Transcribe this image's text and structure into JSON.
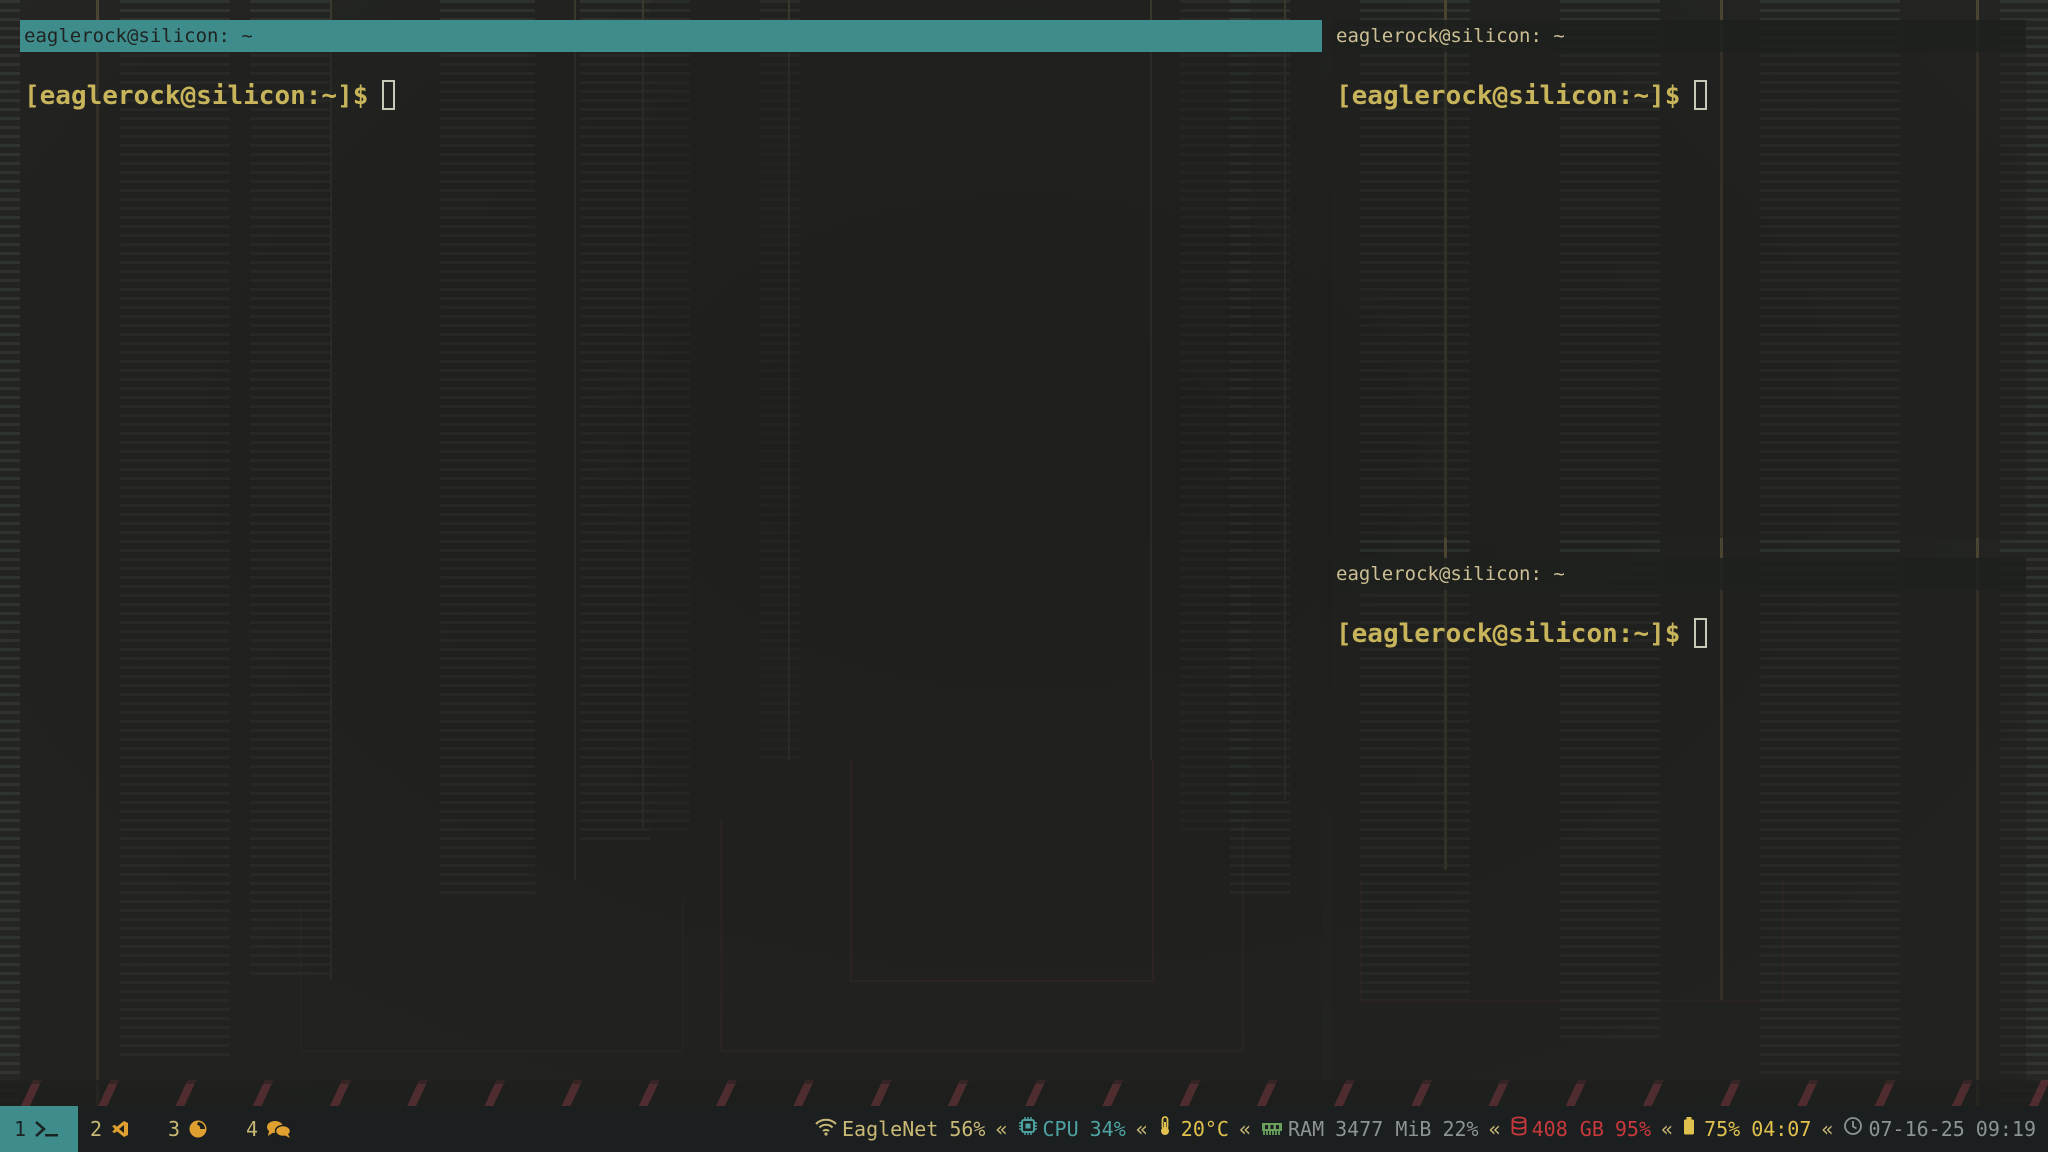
{
  "windows": {
    "main": {
      "title": "eaglerock@silicon: ~",
      "prompt": "[eaglerock@silicon:~]$",
      "focused": true
    },
    "top_right": {
      "title": "eaglerock@silicon: ~",
      "prompt": "[eaglerock@silicon:~]$",
      "focused": false
    },
    "bottom_right": {
      "title": "eaglerock@silicon: ~",
      "prompt": "[eaglerock@silicon:~]$",
      "focused": false
    }
  },
  "workspaces": [
    {
      "num": "1",
      "icon": "terminal-icon",
      "active": true
    },
    {
      "num": "2",
      "icon": "vscode-icon",
      "active": false
    },
    {
      "num": "3",
      "icon": "firefox-icon",
      "active": false
    },
    {
      "num": "4",
      "icon": "chat-icon",
      "active": false
    }
  ],
  "status": {
    "separator": "«",
    "network": {
      "icon": "wifi-icon",
      "ssid": "EagleNet",
      "signal": "56%"
    },
    "cpu": {
      "icon": "cpu-icon",
      "label": "CPU",
      "value": "34%"
    },
    "temperature": {
      "icon": "thermometer-icon",
      "value": "20°C"
    },
    "ram": {
      "icon": "memory-icon",
      "label": "RAM",
      "used": "3477 MiB",
      "percent": "22%"
    },
    "disk": {
      "icon": "database-icon",
      "free": "408 GB",
      "percent": "95%"
    },
    "battery": {
      "icon": "battery-icon",
      "percent": "75%",
      "remaining": "04:07"
    },
    "clock": {
      "icon": "clock-icon",
      "date": "07-16-25",
      "time": "09:19"
    }
  },
  "colors": {
    "focused_title": "#3e8d8c",
    "prompt": "#c8b45a",
    "status_text": "#c9b876",
    "status_teal": "#4ea2a1",
    "disk_red": "#c8383c"
  }
}
